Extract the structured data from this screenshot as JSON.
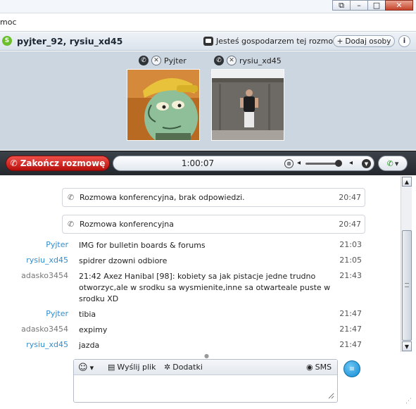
{
  "window": {
    "restore_glyph": "⧉",
    "minimize_glyph": "–",
    "maximize_glyph": "□",
    "close_glyph": "✕"
  },
  "menu": {
    "visible_item": "moc"
  },
  "header": {
    "logo_glyph": "S",
    "title": "pyjter_92, rysiu_xd45",
    "host_text": "Jesteś gospodarzem tej rozmowy",
    "add_button": "Dodaj osoby",
    "add_glyph": "+",
    "info_glyph": "i"
  },
  "participants": [
    {
      "name": "Pyjter",
      "phone_glyph": "✆",
      "mic_glyph": "✕"
    },
    {
      "name": "rysiu_xd45",
      "phone_glyph": "✆",
      "mic_glyph": "✕"
    }
  ],
  "callbar": {
    "end_call": "Zakończ rozmowę",
    "end_glyph": "✆",
    "duration": "1:00:07",
    "mute_glyph": "⊗",
    "vol_low_glyph": "◂",
    "vol_high_glyph": "◂",
    "more_glyph": "▼",
    "call_glyph": "✆",
    "call_caret": "▾",
    "volume_fraction": 0.9
  },
  "chat": {
    "system_messages": [
      {
        "text": "Rozmowa konferencyjna, brak odpowiedzi.",
        "time": "20:47",
        "glyph": "✆"
      },
      {
        "text": "Rozmowa konferencyjna",
        "time": "20:47",
        "glyph": "✆"
      }
    ],
    "messages": [
      {
        "author": "Pyjter",
        "text": "IMG for bulletin boards & forums",
        "time": "21:03",
        "color": "blue"
      },
      {
        "author": "rysiu_xd45",
        "text": "spidrer dzowni odbiore",
        "time": "21:05",
        "color": "blue"
      },
      {
        "author": "adasko3454",
        "text": "21:42 Axez Hanibal [98]: kobiety sa jak pistacje jedne trudno otworzyc,ale w srodku sa wysmienite,inne sa otwarteale puste w srodku XD",
        "time": "21:43",
        "color": "gray"
      },
      {
        "author": "Pyjter",
        "text": "tibia",
        "time": "21:47",
        "color": "blue"
      },
      {
        "author": "adasko3454",
        "text": "expimy",
        "time": "21:47",
        "color": "gray"
      },
      {
        "author": "rysiu_xd45",
        "text": "jazda",
        "time": "21:47",
        "color": "blue"
      }
    ]
  },
  "scroll": {
    "up_glyph": "▲",
    "down_glyph": "▼"
  },
  "composer": {
    "emoticon_glyph": "☺",
    "emoticon_caret": "▾",
    "send_file": "Wyślij plik",
    "send_file_glyph": "▤",
    "addons": "Dodatki",
    "addons_glyph": "✲",
    "sms": "SMS",
    "sms_glyph": "◉",
    "placeholder": "",
    "send_glyph": "≡",
    "grip_glyph": "⋰"
  },
  "colors": {
    "accent_blue": "#2e8ecf",
    "end_call_red": "#d8231c",
    "call_bar": "#2f3439",
    "participants_bg": "#ccd6e1"
  }
}
